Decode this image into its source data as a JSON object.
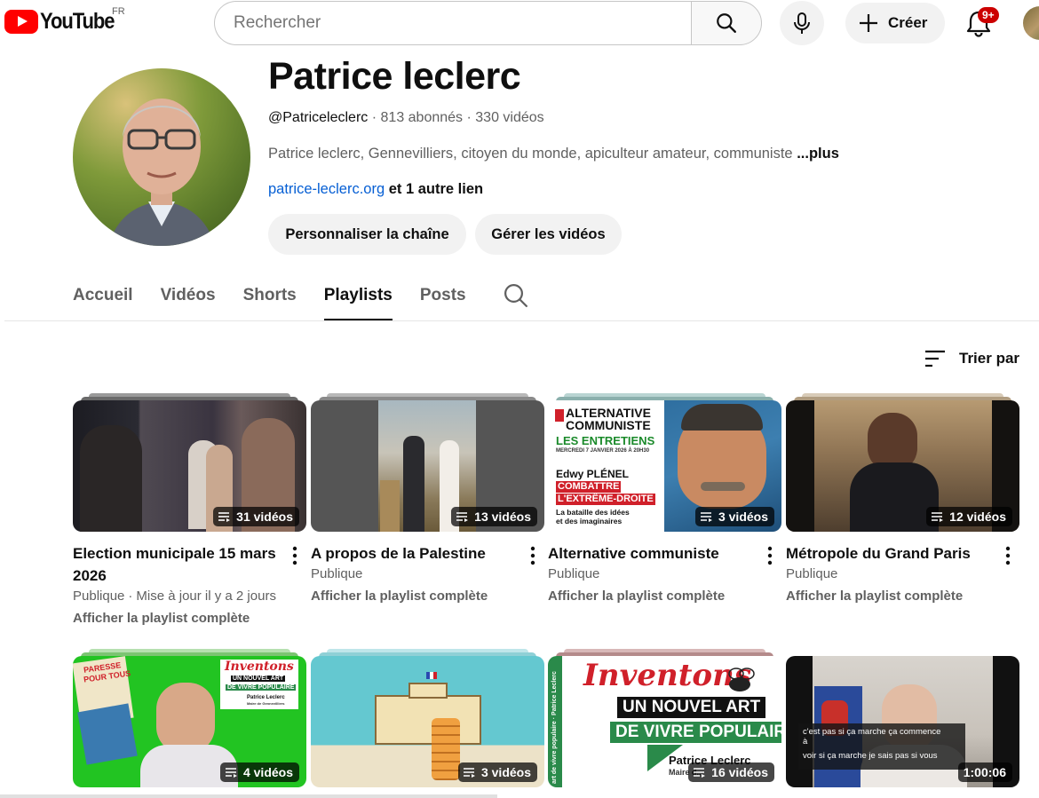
{
  "header": {
    "logo_text": "YouTube",
    "country_code": "FR",
    "search_placeholder": "Rechercher",
    "create_label": "Créer",
    "notifications_badge": "9+"
  },
  "channel": {
    "name": "Patrice leclerc",
    "handle": "@Patriceleclerc",
    "subscribers": "813 abonnés",
    "videos": "330 vidéos",
    "separator": "·",
    "description": "Patrice leclerc, Gennevilliers, citoyen du monde, apiculteur amateur, communiste",
    "more_label": "...plus",
    "link": "patrice-leclerc.org",
    "other_links": "et 1 autre lien",
    "customize_label": "Personnaliser la chaîne",
    "manage_label": "Gérer les vidéos"
  },
  "tabs": [
    {
      "label": "Accueil",
      "active": false
    },
    {
      "label": "Vidéos",
      "active": false
    },
    {
      "label": "Shorts",
      "active": false
    },
    {
      "label": "Playlists",
      "active": true
    },
    {
      "label": "Posts",
      "active": false
    }
  ],
  "sort_label": "Trier par",
  "playlists": [
    {
      "title": "Election municipale 15 mars 2026",
      "count": "31 vidéos",
      "visibility": "Publique",
      "updated": "Mise à jour il y a 2 jours",
      "link": "Afficher la playlist complète"
    },
    {
      "title": "A propos de la Palestine",
      "count": "13 vidéos",
      "visibility": "Publique",
      "link": "Afficher la playlist complète"
    },
    {
      "title": "Alternative communiste",
      "count": "3 vidéos",
      "visibility": "Publique",
      "link": "Afficher la playlist complète"
    },
    {
      "title": "Métropole du Grand Paris",
      "count": "12 vidéos",
      "visibility": "Publique",
      "link": "Afficher la playlist complète"
    },
    {
      "count": "4 vidéos"
    },
    {
      "count": "3 vidéos"
    },
    {
      "count": "16 vidéos"
    },
    {
      "duration": "1:00:06"
    }
  ],
  "thumb_text": {
    "alt_com": {
      "line1": "ALTERNATIVE",
      "line2": "COMMUNISTE",
      "line3": "LES ENTRETIENS",
      "date": "MERCREDI 7 JANVIER 2026 À 20H30",
      "guest": "Edwy PLÉNEL",
      "topic1": "COMBATTRE",
      "topic2": "L'EXTRÊME-DROITE",
      "tagline1": "La bataille des idées",
      "tagline2": "et des imaginaires"
    },
    "paresse": {
      "line1": "PARESSE",
      "line2": "POUR TOUS"
    },
    "inventons_small": {
      "title": "Inventons",
      "line1": "UN NOUVEL ART",
      "line2": "DE VIVRE POPULAIRE",
      "author": "Patrice Leclerc",
      "role": "Maire de Gennevilliers"
    },
    "inventons_big": {
      "title": "Inventons",
      "line1": "UN NOUVEL ART",
      "line2": "DE VIVRE POPULAIRE",
      "author": "Patrice Leclerc",
      "role": "Maire d...",
      "spine": "art de vivre populaire · Patrice Leclerc"
    },
    "subtitle": {
      "line1": "c'est pas si ça marche ça commence",
      "line2": "à",
      "line3": "voir si ça marche je sais pas si vous"
    }
  }
}
